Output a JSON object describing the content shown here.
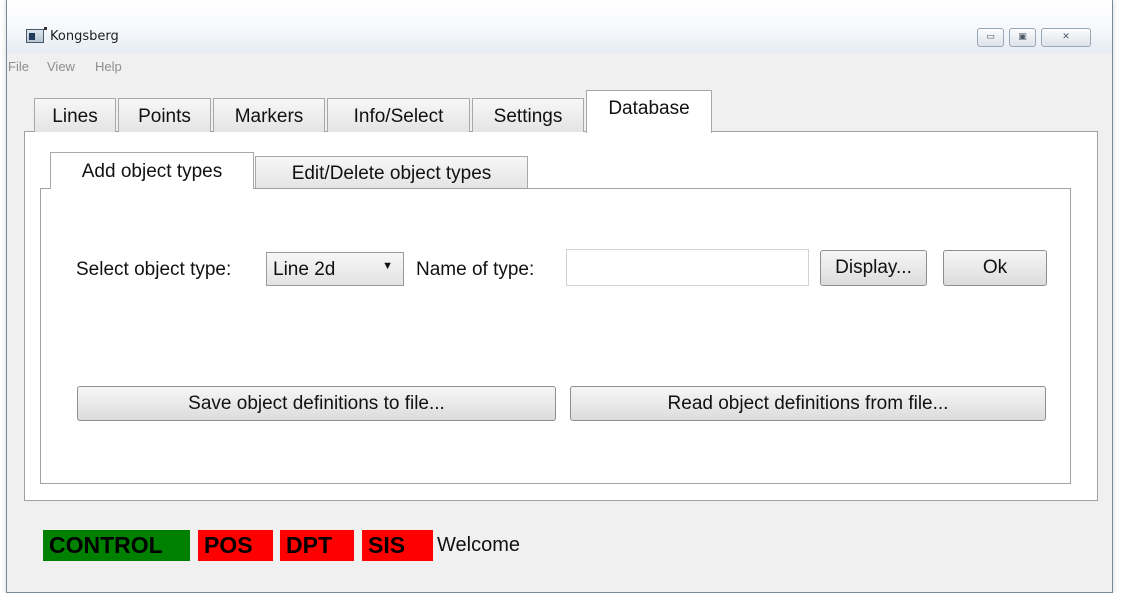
{
  "window": {
    "title": "Kongsberg",
    "controls": {
      "minimize": "▭",
      "maximize": "▣",
      "close": "✕"
    }
  },
  "menu": [
    "File",
    "View",
    "Help"
  ],
  "tabs": [
    {
      "label": "Lines"
    },
    {
      "label": "Points"
    },
    {
      "label": "Markers"
    },
    {
      "label": "Info/Select"
    },
    {
      "label": "Settings"
    },
    {
      "label": "Database",
      "active": true
    }
  ],
  "subtabs": [
    {
      "label": "Add object types",
      "active": true
    },
    {
      "label": "Edit/Delete object types"
    }
  ],
  "form": {
    "select_label": "Select object type:",
    "select_value": "Line 2d",
    "name_label": "Name of type:",
    "name_value": "",
    "display_button": "Display...",
    "ok_button": "Ok",
    "save_button": "Save object definitions to file...",
    "read_button": "Read object definitions from file..."
  },
  "status": [
    {
      "label": "CONTROL",
      "color": "#008000"
    },
    {
      "label": "POS",
      "color": "#ff0000"
    },
    {
      "label": "DPT",
      "color": "#ff0000"
    },
    {
      "label": "SIS",
      "color": "#ff0000"
    }
  ],
  "status_message": "Welcome"
}
